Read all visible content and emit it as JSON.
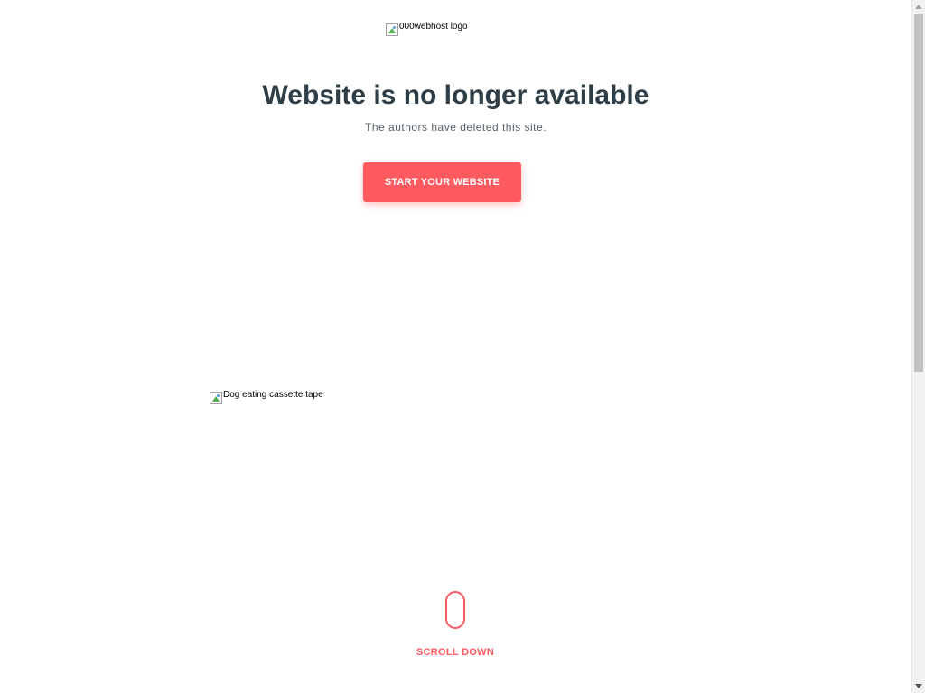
{
  "logo": {
    "alt": "000webhost logo",
    "icon": "broken-image-icon"
  },
  "headline": "Website is no longer available",
  "subline": "The authors have deleted this site.",
  "cta_label": "START YOUR WEBSITE",
  "illustration": {
    "alt": "Dog eating cassette tape",
    "icon": "broken-image-icon"
  },
  "scroll": {
    "label": "SCROLL DOWN",
    "icon": "mouse-icon"
  },
  "colors": {
    "accent": "#ff5a5f",
    "heading": "#2f3e46",
    "body_text": "#555f66",
    "background": "#ffffff"
  }
}
